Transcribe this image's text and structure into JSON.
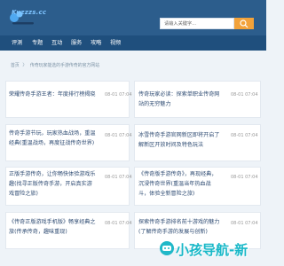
{
  "header": {
    "logo_text": "Kuzzzs.cc",
    "search": {
      "placeholder": "请输入关键字..."
    }
  },
  "nav": {
    "items": [
      "评测",
      "专题",
      "互动",
      "服务",
      "攻略",
      "视频"
    ]
  },
  "breadcrumb": {
    "home": "首页",
    "separator": "〉",
    "current": "传奇玩家能选的手游传奇的官方网站"
  },
  "cards": [
    {
      "title": "荣耀传奇手游王者：年度排行榜揭晓",
      "date": "08-01 07:04"
    },
    {
      "title": "传奇玩家必读：探索单职业传奇网站的无穷魅力",
      "date": "08-01 07:04"
    },
    {
      "title": "传奇手游节玩，玩家热血战场，重温经典(重温战场，再度征战传奇世界)",
      "date": "08-01 07:04"
    },
    {
      "title": "冰雪传奇手游官网新区即将开启了解新区开放时间及特色玩法",
      "date": "08-01 07:04"
    },
    {
      "title": "正版手游传奇，让你畅快体验游戏乐趣(找寻正版传奇手游，开启真实游戏冒险之旅)",
      "date": "08-01 07:04"
    },
    {
      "title": "《传奇版手游传奇》，再现经典，沉浸传奇世界(重温当年热血战斗，体验全新冒险之旅)",
      "date": "08-01 07:04"
    },
    {
      "title": "《传奇正版游戏手机版》畅享经典之旅(传承传奇，趣味重现)",
      "date": "08-01 07:04"
    },
    {
      "title": "探索传奇手游排名前十游戏的魅力(了解传奇手游的发展与创新)",
      "date": "08-01 07:04"
    }
  ],
  "watermark": {
    "text": "小孩导航-新"
  },
  "colors": {
    "header_bg": "#2c5d8c",
    "nav_bg": "#1f4f7d",
    "page_bg": "#eef3f8",
    "card_bg": "#ffffff",
    "title_color": "#2f4c73",
    "accent": "#f2a23a",
    "watermark": "#18b8c8"
  },
  "icons": {
    "search_button": "search-icon",
    "logo": "logo-icon"
  }
}
